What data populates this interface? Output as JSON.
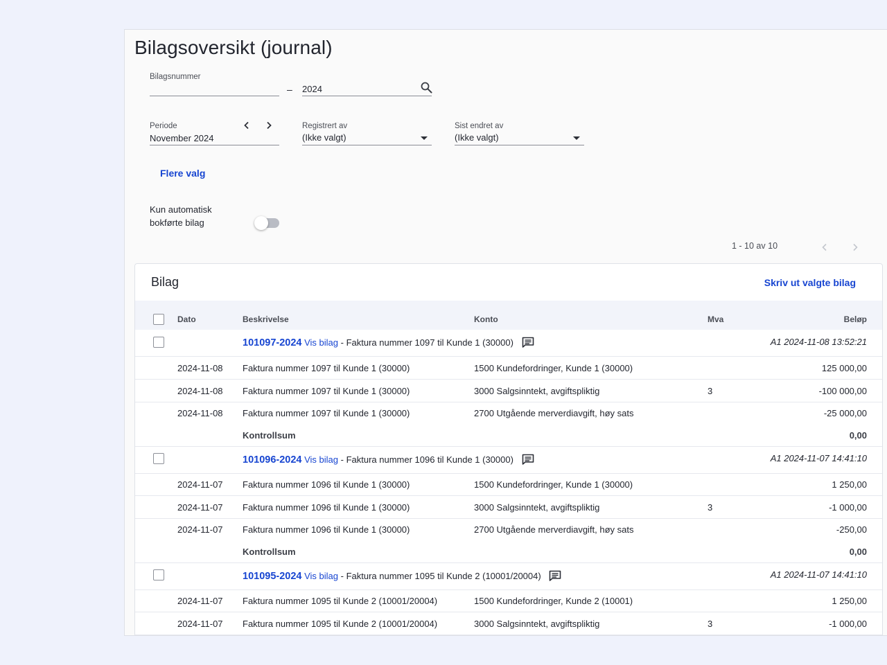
{
  "title": "Bilagsoversikt (journal)",
  "filters": {
    "bilagsnummer_label": "Bilagsnummer",
    "bilagsnummer_from": "",
    "range_dash": "–",
    "bilagsnummer_to": "2024",
    "periode_label": "Periode",
    "periode_value": "November 2024",
    "registrert_label": "Registrert av",
    "registrert_value": "(Ikke valgt)",
    "endret_label": "Sist endret av",
    "endret_value": "(Ikke valgt)",
    "more_options": "Flere valg",
    "auto_toggle_line1": "Kun automatisk",
    "auto_toggle_line2": "bokførte bilag",
    "auto_toggle_on": false
  },
  "pager": {
    "text": "1 - 10 av 10"
  },
  "card": {
    "title": "Bilag",
    "print_action": "Skriv ut valgte bilag",
    "columns": {
      "dato": "Dato",
      "beskrivelse": "Beskrivelse",
      "konto": "Konto",
      "mva": "Mva",
      "belop": "Beløp"
    }
  },
  "vouchers": [
    {
      "number": "101097-2024",
      "view_link": "Vis bilag",
      "separator": " - ",
      "description": "Faktura nummer 1097 til Kunde 1 (30000)",
      "meta": "A1 2024-11-08 13:52:21",
      "lines": [
        {
          "date": "2024-11-08",
          "desc": "Faktura nummer 1097 til Kunde 1 (30000)",
          "account": "1500 Kundefordringer, Kunde 1 (30000)",
          "vat": "",
          "amount": "125 000,00"
        },
        {
          "date": "2024-11-08",
          "desc": "Faktura nummer 1097 til Kunde 1 (30000)",
          "account": "3000 Salgsinntekt, avgiftspliktig",
          "vat": "3",
          "amount": "-100 000,00"
        },
        {
          "date": "2024-11-08",
          "desc": "Faktura nummer 1097 til Kunde 1 (30000)",
          "account": "2700 Utgående merverdiavgift, høy sats",
          "vat": "",
          "amount": "-25 000,00"
        }
      ],
      "control_label": "Kontrollsum",
      "control_sum": "0,00"
    },
    {
      "number": "101096-2024",
      "view_link": "Vis bilag",
      "separator": " - ",
      "description": "Faktura nummer 1096 til Kunde 1 (30000)",
      "meta": "A1 2024-11-07 14:41:10",
      "lines": [
        {
          "date": "2024-11-07",
          "desc": "Faktura nummer 1096 til Kunde 1 (30000)",
          "account": "1500 Kundefordringer, Kunde 1 (30000)",
          "vat": "",
          "amount": "1 250,00"
        },
        {
          "date": "2024-11-07",
          "desc": "Faktura nummer 1096 til Kunde 1 (30000)",
          "account": "3000 Salgsinntekt, avgiftspliktig",
          "vat": "3",
          "amount": "-1 000,00"
        },
        {
          "date": "2024-11-07",
          "desc": "Faktura nummer 1096 til Kunde 1 (30000)",
          "account": "2700 Utgående merverdiavgift, høy sats",
          "vat": "",
          "amount": "-250,00"
        }
      ],
      "control_label": "Kontrollsum",
      "control_sum": "0,00"
    },
    {
      "number": "101095-2024",
      "view_link": "Vis bilag",
      "separator": " - ",
      "description": "Faktura nummer 1095 til Kunde 2 (10001/20004)",
      "meta": "A1 2024-11-07 14:41:10",
      "lines": [
        {
          "date": "2024-11-07",
          "desc": "Faktura nummer 1095 til Kunde 2 (10001/20004)",
          "account": "1500 Kundefordringer, Kunde 2 (10001)",
          "vat": "",
          "amount": "1 250,00"
        },
        {
          "date": "2024-11-07",
          "desc": "Faktura nummer 1095 til Kunde 2 (10001/20004)",
          "account": "3000 Salgsinntekt, avgiftspliktig",
          "vat": "3",
          "amount": "-1 000,00"
        }
      ]
    }
  ]
}
